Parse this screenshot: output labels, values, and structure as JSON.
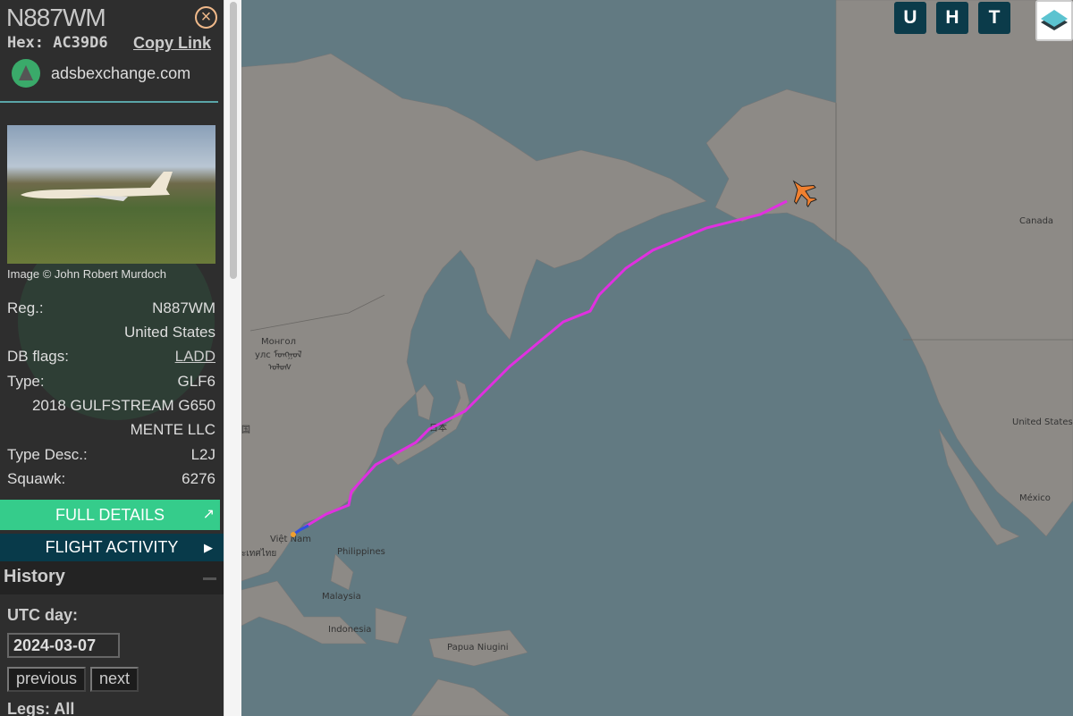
{
  "aircraft": {
    "title": "N887WM",
    "hex_label": "Hex:",
    "hex": "AC39D6",
    "copy_link": "Copy Link",
    "source": "adsbexchange.com",
    "photo_credit": "Image © John Robert Murdoch"
  },
  "details": [
    {
      "label": "Reg.:",
      "value": "N887WM"
    },
    {
      "label": "",
      "value": "United States"
    },
    {
      "label": "DB flags:",
      "value": "LADD"
    },
    {
      "label": "Type:",
      "value": "GLF6"
    },
    {
      "label": "",
      "value": "2018 GULFSTREAM G650"
    },
    {
      "label": "",
      "value": "MENTE LLC"
    },
    {
      "label": "Type Desc.:",
      "value": "L2J"
    },
    {
      "label": "Squawk:",
      "value": "6276"
    }
  ],
  "buttons": {
    "full_details": "FULL DETAILS",
    "flight_activity": "FLIGHT ACTIVITY"
  },
  "history": {
    "title": "History",
    "utc_label": "UTC day:",
    "date": "2024-03-07",
    "previous": "previous",
    "next": "next",
    "legs": "Legs: All"
  },
  "map_buttons": [
    "U",
    "H",
    "T"
  ],
  "map_labels": {
    "mongolia1": "Монгол",
    "mongolia2": "улс ᠮᠣᠩᠭᠣᠯ",
    "mongolia3": "ᠤᠯᠤᠰ",
    "china": "国",
    "japan": "日本",
    "vietnam": "Việt Nam",
    "thailand": "ะเทศไทย",
    "philippines": "Philippines",
    "malaysia": "Malaysia",
    "indonesia": "Indonesia",
    "papua": "Papua Niugini",
    "canada": "Canada",
    "us": "United States",
    "mexico": "México"
  },
  "colors": {
    "track": "#e030e0",
    "accent": "#35cc8b",
    "plane": "#f08030",
    "water": "#627a82",
    "land": "#8d8a86"
  }
}
